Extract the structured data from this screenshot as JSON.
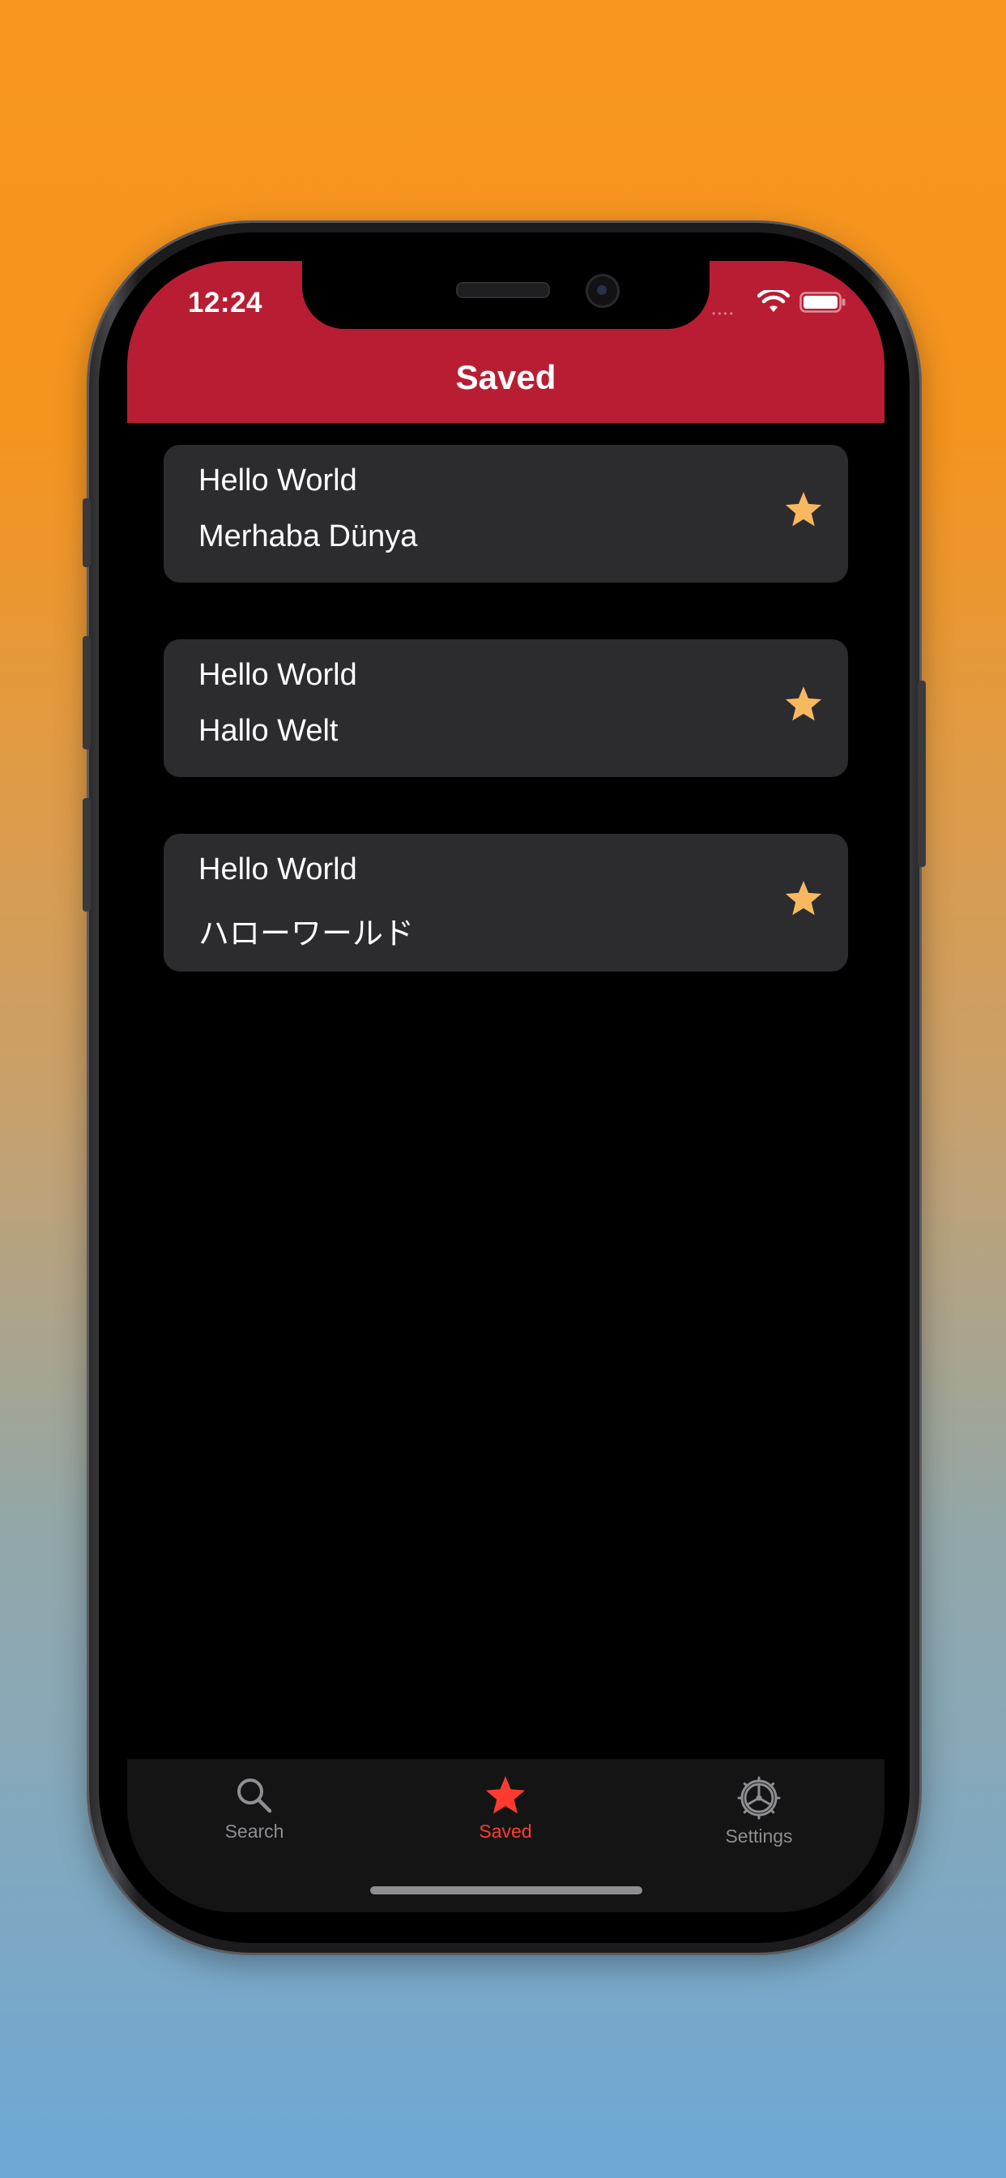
{
  "status_bar": {
    "time": "12:24",
    "signal_dots": "••••",
    "icons": [
      "wifi-icon",
      "battery-icon"
    ]
  },
  "nav": {
    "title": "Saved"
  },
  "saved_items": [
    {
      "source": "Hello World",
      "translation": "Merhaba Dünya",
      "icon": "star-icon"
    },
    {
      "source": "Hello World",
      "translation": "Hallo Welt",
      "icon": "star-icon"
    },
    {
      "source": "Hello World",
      "translation": "ハローワールド",
      "icon": "star-icon"
    }
  ],
  "tabbar": {
    "tabs": [
      {
        "label": "Search",
        "icon": "magnifier-icon",
        "active": false
      },
      {
        "label": "Saved",
        "icon": "star-icon",
        "active": true
      },
      {
        "label": "Settings",
        "icon": "gear-icon",
        "active": false
      }
    ]
  },
  "colors": {
    "nav_background": "#b91d33",
    "screen_background": "#000000",
    "card_background": "#2c2c2e",
    "star": "#f7b860",
    "tab_active": "#ff3b30",
    "tab_inactive": "#8e8e93",
    "tabbar_background": "#141414"
  }
}
